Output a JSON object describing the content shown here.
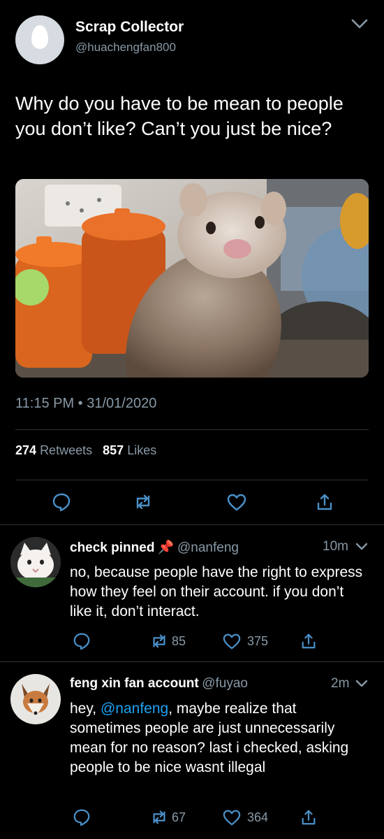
{
  "main_tweet": {
    "display_name": "Scrap Collector",
    "handle": "@huachengfan800",
    "text": "Why do you have to be mean to people you don’t like? Can’t you just be nice?",
    "timestamp": "11:15 PM • 31/01/2020",
    "retweets_count": "274",
    "retweets_label": "Retweets",
    "likes_count": "857",
    "likes_label": "Likes"
  },
  "replies": [
    {
      "display_name": "check pinned",
      "emoji": "📌",
      "handle": "@nanfeng",
      "time": "10m",
      "text": "no, because people have the right to express how they feel on their account. if you don’t like it, don’t interact.",
      "retweets": "85",
      "likes": "375"
    },
    {
      "display_name": "feng xin fan account",
      "handle": "@fuyao",
      "time": "2m",
      "text_prefix": "hey, ",
      "mention": "@nanfeng",
      "text_suffix": ", maybe realize that sometimes people are just unnecessarily mean for no reason? last i checked, asking people to be nice wasnt illegal",
      "retweets": "67",
      "likes": "364"
    }
  ],
  "colors": {
    "background": "#000000",
    "text": "#ffffff",
    "muted": "#8899a6",
    "link": "#1da1f2",
    "icon": "#4a90c8",
    "divider": "#2f3336"
  },
  "icons": [
    "chevron-down-icon",
    "reply-icon",
    "retweet-icon",
    "like-icon",
    "share-icon"
  ]
}
